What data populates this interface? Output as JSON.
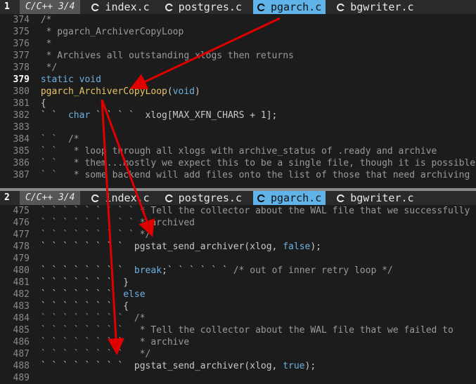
{
  "pane1": {
    "number": "1",
    "meta": "C/C++ 3/4",
    "tabs": [
      {
        "label": "index.c",
        "icon": "c-file-icon",
        "active": false
      },
      {
        "label": "postgres.c",
        "icon": "c-file-icon",
        "active": false
      },
      {
        "label": "pgarch.c",
        "icon": "c-file-icon",
        "active": true
      },
      {
        "label": "bgwriter.c",
        "icon": "c-file-icon",
        "active": false
      }
    ],
    "lines": [
      {
        "n": "374",
        "t": " /*"
      },
      {
        "n": "375",
        "t": "  * pgarch_ArchiverCopyLoop"
      },
      {
        "n": "376",
        "t": "  *"
      },
      {
        "n": "377",
        "t": "  * Archives all outstanding xlogs then returns"
      },
      {
        "n": "378",
        "t": "  */"
      },
      {
        "n": "379",
        "t": " static void"
      },
      {
        "n": "380",
        "t": " pgarch_ArchiverCopyLoop(void)"
      },
      {
        "n": "381",
        "t": " {"
      },
      {
        "n": "382",
        "t": " ` `  char ` ` ` `  xlog[MAX_XFN_CHARS + 1];"
      },
      {
        "n": "383",
        "t": ""
      },
      {
        "n": "384",
        "t": " ` `  /*"
      },
      {
        "n": "385",
        "t": " ` `   * loop through all xlogs with archive_status of .ready and archive"
      },
      {
        "n": "386",
        "t": " ` `   * them...mostly we expect this to be a single file, though it is possible"
      },
      {
        "n": "387",
        "t": " ` `   * some backend will add files onto the list of those that need archiving"
      }
    ]
  },
  "pane2": {
    "number": "2",
    "meta": "C/C++ 3/4",
    "tabs": [
      {
        "label": "index.c",
        "icon": "c-file-icon",
        "active": false
      },
      {
        "label": "postgres.c",
        "icon": "c-file-icon",
        "active": false
      },
      {
        "label": "pgarch.c",
        "icon": "c-file-icon",
        "active": true
      },
      {
        "label": "bgwriter.c",
        "icon": "c-file-icon",
        "active": false
      }
    ],
    "lines": [
      {
        "n": "475",
        "t": " ` ` ` ` ` ` ` ` ` * Tell the collector about the WAL file that we successfully"
      },
      {
        "n": "476",
        "t": " ` ` ` ` ` ` ` ` ` * archived"
      },
      {
        "n": "477",
        "t": " ` ` ` ` ` ` ` ` ` */"
      },
      {
        "n": "478",
        "t": " ` ` ` ` ` ` ` `  pgstat_send_archiver(xlog, false);"
      },
      {
        "n": "479",
        "t": ""
      },
      {
        "n": "480",
        "t": " ` ` ` ` ` ` ` `  break;` ` ` ` ` ` /* out of inner retry loop */"
      },
      {
        "n": "481",
        "t": " ` ` ` ` ` ` `  }"
      },
      {
        "n": "482",
        "t": " ` ` ` ` ` ` `  else"
      },
      {
        "n": "483",
        "t": " ` ` ` ` ` ` `  {"
      },
      {
        "n": "484",
        "t": " ` ` ` ` ` ` ` `  /*"
      },
      {
        "n": "485",
        "t": " ` ` ` ` ` ` ` `   * Tell the collector about the WAL file that we failed to"
      },
      {
        "n": "486",
        "t": " ` ` ` ` ` ` ` `   * archive"
      },
      {
        "n": "487",
        "t": " ` ` ` ` ` ` ` `   */"
      },
      {
        "n": "488",
        "t": " ` ` ` ` ` ` ` `  pgstat_send_archiver(xlog, true);"
      },
      {
        "n": "489",
        "t": ""
      }
    ]
  },
  "colors": {
    "active_tab": "#5fb3e8",
    "comment": "#9a9a9a",
    "keyword": "#6fb0e0",
    "function": "#e8c46a",
    "arrow": "#e00000"
  }
}
